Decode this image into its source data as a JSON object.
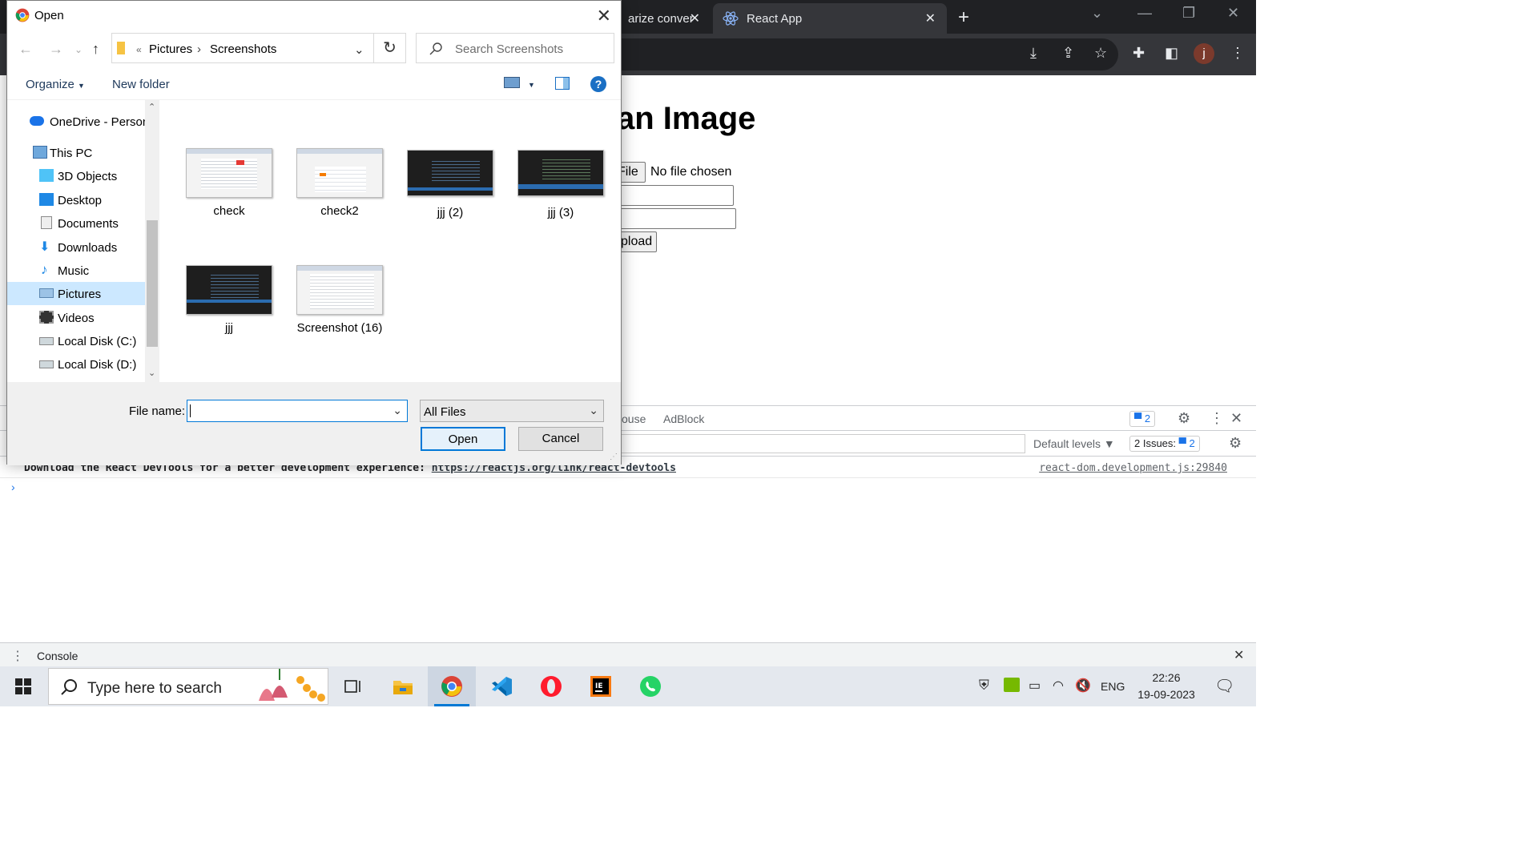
{
  "browser": {
    "tabs": [
      {
        "label": "arize conver",
        "active": false
      },
      {
        "label": "React App",
        "active": true
      }
    ],
    "avatar_letter": "j"
  },
  "page": {
    "heading": "an Image",
    "file_button": "File",
    "file_status": "No file chosen",
    "upload_button": "pload"
  },
  "devtools": {
    "tabs": [
      "ouse",
      "AdBlock"
    ],
    "message_count": "2",
    "default_levels": "Default levels ▼",
    "issues_label": "2 Issues:",
    "issues_count": "2",
    "console_message": "Download the React DevTools for a better development experience:",
    "console_link": "https://reactjs.org/link/react-devtools",
    "console_source": "react-dom.development.js:29840",
    "drawer_tab": "Console"
  },
  "dialog": {
    "title": "Open",
    "breadcrumb": [
      "Pictures",
      "Screenshots"
    ],
    "search_placeholder": "Search Screenshots",
    "organize": "Organize",
    "new_folder": "New folder",
    "nav": [
      {
        "label": "OneDrive - Person",
        "icon": "onedrive-icon"
      },
      {
        "label": "This PC",
        "icon": "computer-icon"
      },
      {
        "label": "3D Objects",
        "icon": "cube-icon"
      },
      {
        "label": "Desktop",
        "icon": "desktop-icon"
      },
      {
        "label": "Documents",
        "icon": "documents-icon"
      },
      {
        "label": "Downloads",
        "icon": "download-arrow-icon"
      },
      {
        "label": "Music",
        "icon": "music-note-icon"
      },
      {
        "label": "Pictures",
        "icon": "pictures-icon",
        "selected": true
      },
      {
        "label": "Videos",
        "icon": "film-icon"
      },
      {
        "label": "Local Disk (C:)",
        "icon": "drive-icon"
      },
      {
        "label": "Local Disk (D:)",
        "icon": "drive-icon"
      }
    ],
    "files": [
      {
        "name": "check",
        "theme": "light"
      },
      {
        "name": "check2",
        "theme": "light"
      },
      {
        "name": "jjj (2)",
        "theme": "dark"
      },
      {
        "name": "jjj (3)",
        "theme": "dark"
      },
      {
        "name": "jjj",
        "theme": "dark"
      },
      {
        "name": "Screenshot (16)",
        "theme": "light"
      }
    ],
    "file_name_label": "File name:",
    "file_name_value": "",
    "filter": "All Files",
    "open_button": "Open",
    "cancel_button": "Cancel"
  },
  "taskbar": {
    "search_placeholder": "Type here to search",
    "language": "ENG",
    "time": "22:26",
    "date": "19-09-2023"
  },
  "colors": {
    "accent": "#0078d7",
    "chrome_dark": "#202124",
    "selection": "#cce8ff"
  }
}
